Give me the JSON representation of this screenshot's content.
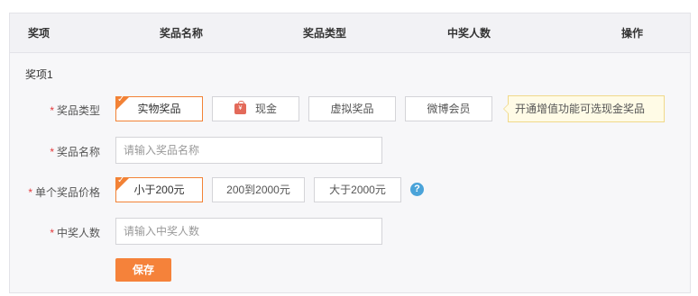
{
  "table_header": {
    "columns": [
      "奖项",
      "奖品名称",
      "奖品类型",
      "中奖人数",
      "操作"
    ]
  },
  "section": {
    "title": "奖项1"
  },
  "form": {
    "required_mark": "*",
    "prize_type": {
      "label": "奖品类型",
      "options": [
        "实物奖品",
        "现金",
        "虚拟奖品",
        "微博会员"
      ],
      "selected": "实物奖品",
      "tip": "开通增值功能可选现金奖品"
    },
    "prize_name": {
      "label": "奖品名称",
      "placeholder": "请输入奖品名称"
    },
    "unit_price": {
      "label": "单个奖品价格",
      "options": [
        "小于200元",
        "200到2000元",
        "大于2000元"
      ],
      "selected": "小于200元",
      "help_glyph": "?"
    },
    "winners": {
      "label": "中奖人数",
      "placeholder": "请输入中奖人数"
    },
    "save_label": "保存"
  },
  "icons": {
    "check": "check-icon",
    "cash": "red-envelope-icon",
    "help": "question-icon"
  },
  "colors": {
    "accent": "#f5823a",
    "required": "#e4393c",
    "help": "#4aa3d9",
    "tip_bg": "#fffbe6"
  }
}
